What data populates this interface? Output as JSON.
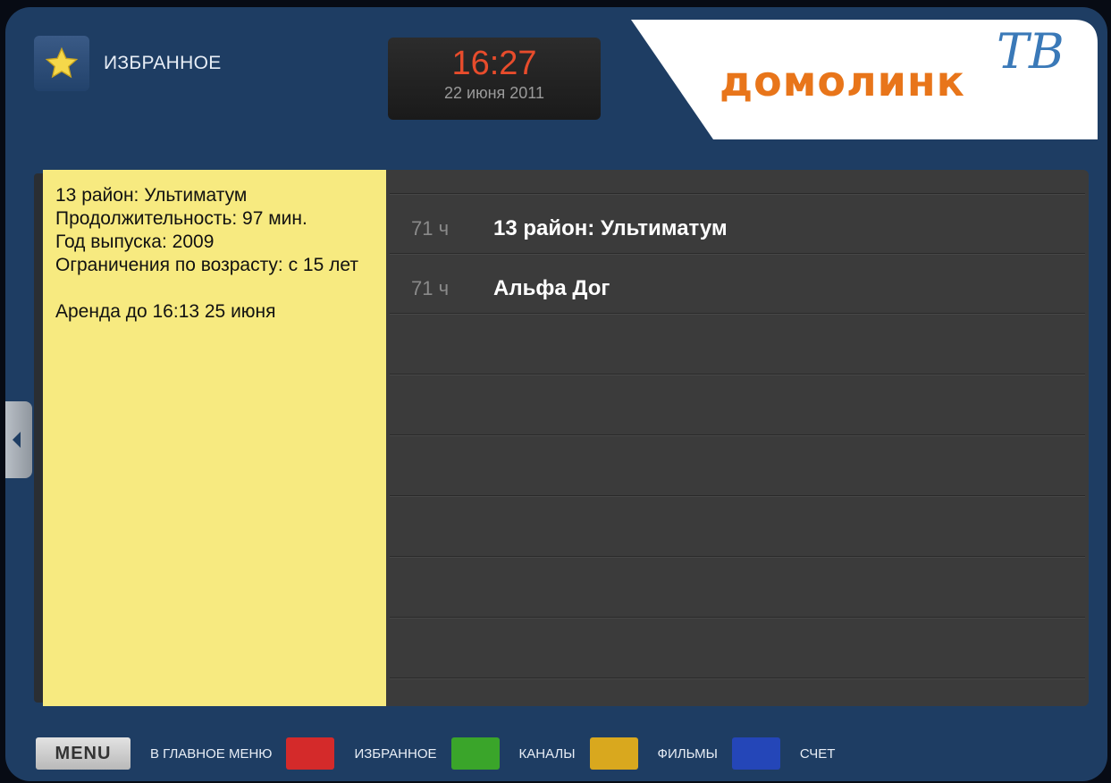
{
  "header": {
    "title": "ИЗБРАННОЕ",
    "icon": "star-icon"
  },
  "clock": {
    "time": "16:27",
    "date": "22 июня 2011"
  },
  "logo": {
    "text": "домолинк",
    "suffix": "ТВ"
  },
  "info": {
    "lines": [
      "13 район: Ультиматум",
      "Продолжительность: 97 мин.",
      "Год выпуска: 2009",
      "Ограничения по возрасту: с 15 лет",
      "",
      "Аренда до 16:13 25 июня"
    ]
  },
  "list": {
    "items": [
      {
        "hours": "71 ч",
        "title": "13 район: Ультиматум"
      },
      {
        "hours": "71 ч",
        "title": "Альфа Дог"
      }
    ]
  },
  "footer": {
    "menu_label": "MENU",
    "main_menu": "В ГЛАВНОЕ МЕНЮ",
    "keys": [
      {
        "color": "#d42a2a",
        "label": "ИЗБРАННОЕ"
      },
      {
        "color": "#3aa52a",
        "label": "КАНАЛЫ"
      },
      {
        "color": "#d9a81e",
        "label": "ФИЛЬМЫ"
      },
      {
        "color": "#2446b8",
        "label": "СЧЕТ"
      }
    ]
  },
  "colors": {
    "frame": "#1e3d63",
    "info_bg": "#f7ea80",
    "list_bg": "#3b3b3b",
    "clock_time": "#e84c2c",
    "logo": "#e8751a"
  }
}
